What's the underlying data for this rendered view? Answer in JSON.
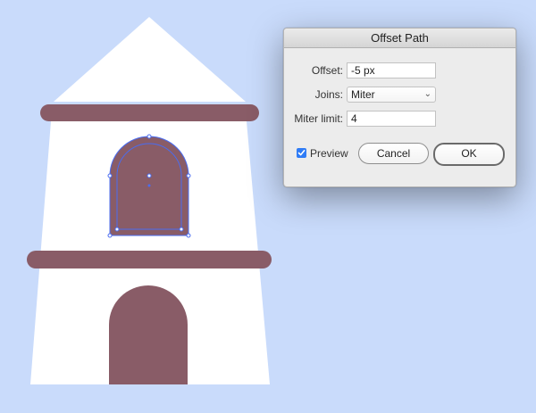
{
  "dialog": {
    "title": "Offset Path",
    "offset_label": "Offset:",
    "offset_value": "-5 px",
    "joins_label": "Joins:",
    "joins_value": "Miter",
    "miter_label": "Miter limit:",
    "miter_value": "4",
    "preview_label": "Preview",
    "preview_checked": true,
    "cancel_label": "Cancel",
    "ok_label": "OK"
  },
  "colors": {
    "background": "#c9dbfb",
    "building": "#ffffff",
    "trim": "#895c67",
    "selection": "#4a6cf0"
  }
}
